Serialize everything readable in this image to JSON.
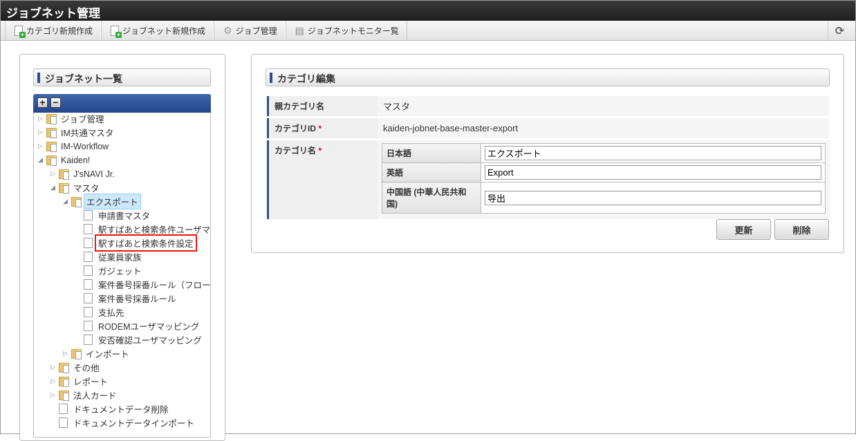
{
  "title": "ジョブネット管理",
  "toolbar": {
    "items": [
      "カテゴリ新規作成",
      "ジョブネット新規作成",
      "ジョブ管理",
      "ジョブネットモニター覧"
    ],
    "refresh": "⟳"
  },
  "left": {
    "title": "ジョブネット一覧",
    "expand_all": "+",
    "collapse_all": "−",
    "tree": [
      {
        "label": "ジョブ管理",
        "level": 0,
        "type": "folder",
        "state": "collapsed"
      },
      {
        "label": "IM共通マスタ",
        "level": 0,
        "type": "folder",
        "state": "collapsed"
      },
      {
        "label": "IM-Workflow",
        "level": 0,
        "type": "folder",
        "state": "collapsed"
      },
      {
        "label": "Kaiden!",
        "level": 0,
        "type": "folder",
        "state": "expanded"
      },
      {
        "label": "J'sNAVI Jr.",
        "level": 1,
        "type": "folder",
        "state": "collapsed"
      },
      {
        "label": "マスタ",
        "level": 1,
        "type": "folder",
        "state": "expanded"
      },
      {
        "label": "エクスポート",
        "level": 2,
        "type": "folder",
        "state": "expanded",
        "selected": true
      },
      {
        "label": "申請書マスタ",
        "level": 3,
        "type": "file"
      },
      {
        "label": "駅すぱあと検索条件ユーザマスタ",
        "level": 3,
        "type": "file"
      },
      {
        "label": "駅すぱあと検索条件設定",
        "level": 3,
        "type": "file",
        "highlighted": true
      },
      {
        "label": "従業員家族",
        "level": 3,
        "type": "file"
      },
      {
        "label": "ガジェット",
        "level": 3,
        "type": "file"
      },
      {
        "label": "案件番号採番ルール（フロー）",
        "level": 3,
        "type": "file"
      },
      {
        "label": "案件番号採番ルール",
        "level": 3,
        "type": "file"
      },
      {
        "label": "支払先",
        "level": 3,
        "type": "file"
      },
      {
        "label": "RODEMユーザマッピング",
        "level": 3,
        "type": "file"
      },
      {
        "label": "安否確認ユーザマッピング",
        "level": 3,
        "type": "file"
      },
      {
        "label": "インポート",
        "level": 2,
        "type": "folder",
        "state": "collapsed"
      },
      {
        "label": "その他",
        "level": 1,
        "type": "folder",
        "state": "collapsed"
      },
      {
        "label": "レポート",
        "level": 1,
        "type": "folder",
        "state": "collapsed"
      },
      {
        "label": "法人カード",
        "level": 1,
        "type": "folder",
        "state": "collapsed"
      },
      {
        "label": "ドキュメントデータ削除",
        "level": 1,
        "type": "file"
      },
      {
        "label": "ドキュメントデータインポート",
        "level": 1,
        "type": "file"
      }
    ]
  },
  "right": {
    "title": "カテゴリ編集",
    "parent_label": "親カテゴリ名",
    "parent_value": "マスタ",
    "id_label": "カテゴリID",
    "id_value": "kaiden-jobnet-base-master-export",
    "name_label": "カテゴリ名",
    "required": "*",
    "langs": [
      {
        "label": "日本語",
        "value": "エクスポート"
      },
      {
        "label": "英語",
        "value": "Export"
      },
      {
        "label": "中国語 (中華人民共和国)",
        "value": "导出"
      }
    ],
    "update": "更新",
    "delete": "削除"
  }
}
